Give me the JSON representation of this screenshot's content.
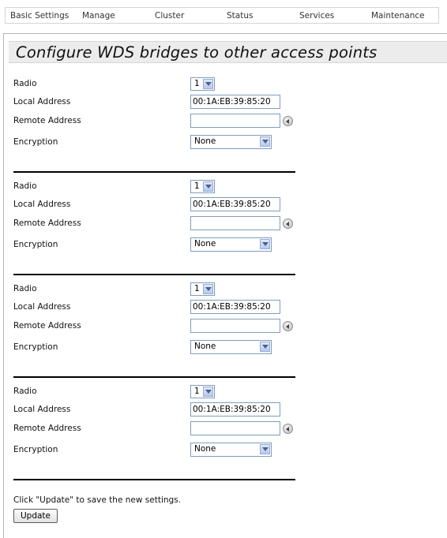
{
  "nav": {
    "tabs": [
      {
        "label": "Basic Settings"
      },
      {
        "label": "Manage"
      },
      {
        "label": "Cluster"
      },
      {
        "label": "Status"
      },
      {
        "label": "Services"
      },
      {
        "label": "Maintenance"
      }
    ]
  },
  "page": {
    "title": "Configure WDS bridges to other access points"
  },
  "labels": {
    "radio": "Radio",
    "local_address": "Local Address",
    "remote_address": "Remote Address",
    "encryption": "Encryption"
  },
  "bridges": [
    {
      "radio": "1",
      "local_address": "00:1A:EB:39:85:20",
      "remote_address": "",
      "encryption": "None"
    },
    {
      "radio": "1",
      "local_address": "00:1A:EB:39:85:20",
      "remote_address": "",
      "encryption": "None"
    },
    {
      "radio": "1",
      "local_address": "00:1A:EB:39:85:20",
      "remote_address": "",
      "encryption": "None"
    },
    {
      "radio": "1",
      "local_address": "00:1A:EB:39:85:20",
      "remote_address": "",
      "encryption": "None"
    }
  ],
  "footer": {
    "note": "Click \"Update\" to save the new settings.",
    "update_label": "Update"
  }
}
